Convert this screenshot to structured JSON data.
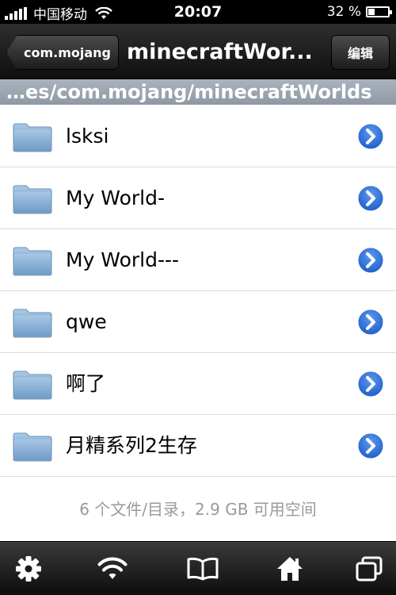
{
  "status_bar": {
    "carrier": "中国移动",
    "time": "20:07",
    "battery_percent": "32 %",
    "battery_level": 0.32
  },
  "nav": {
    "back_label": "com.mojang",
    "title": "minecraftWor...",
    "edit_label": "编辑"
  },
  "path": {
    "text": "…es/com.mojang/minecraftWorlds"
  },
  "items": [
    {
      "name": "lsksi"
    },
    {
      "name": "My World-"
    },
    {
      "name": "My World---"
    },
    {
      "name": "qwe"
    },
    {
      "name": "啊了"
    },
    {
      "name": "月精系列2生存"
    }
  ],
  "summary": "6 个文件/目录，2.9 GB 可用空间",
  "toolbar": {
    "icons": [
      "gear-icon",
      "wifi-icon",
      "book-icon",
      "home-icon",
      "windows-icon"
    ]
  },
  "colors": {
    "disclosure_blue": "#2f6fd8",
    "folder_blue": "#7ea8cf",
    "path_bar": "#9aa4af"
  }
}
